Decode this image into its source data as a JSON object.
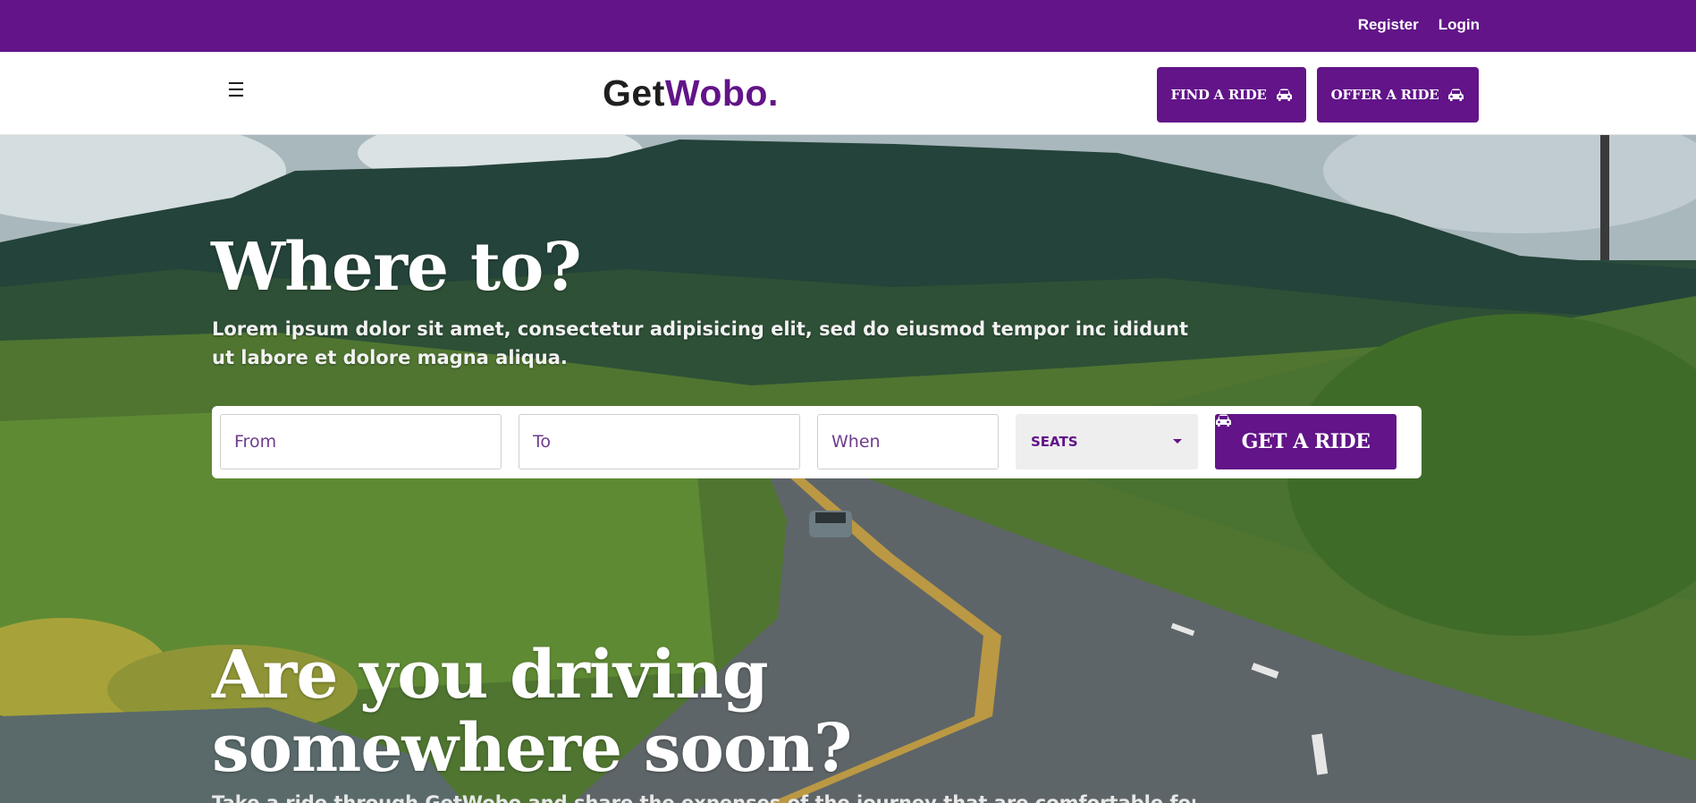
{
  "topbar": {
    "register": "Register",
    "login": "Login"
  },
  "navbar": {
    "menu_icon": "☰",
    "logo_dark": "Get",
    "logo_brand": "Wobo.",
    "find_ride": "FIND A RIDE",
    "offer_ride": "OFFER A RIDE"
  },
  "hero": {
    "title": "Where to?",
    "subtitle": "Lorem ipsum dolor sit amet, consectetur adipisicing elit, sed do eiusmod tempor inc ididunt ut labore et dolore magna aliqua.",
    "search": {
      "from_placeholder": "From",
      "to_placeholder": "To",
      "when_placeholder": "When",
      "seats_label": "SEATS",
      "submit_label": "GET A RIDE"
    }
  },
  "driving": {
    "title": "Are you driving somewhere soon?",
    "subtitle": "Take a ride through GetWobo and share the expenses of the journey that are comfortable for..."
  },
  "colors": {
    "brand": "#621488",
    "white": "#ffffff"
  },
  "icons": [
    "menu-icon",
    "car-icon"
  ]
}
